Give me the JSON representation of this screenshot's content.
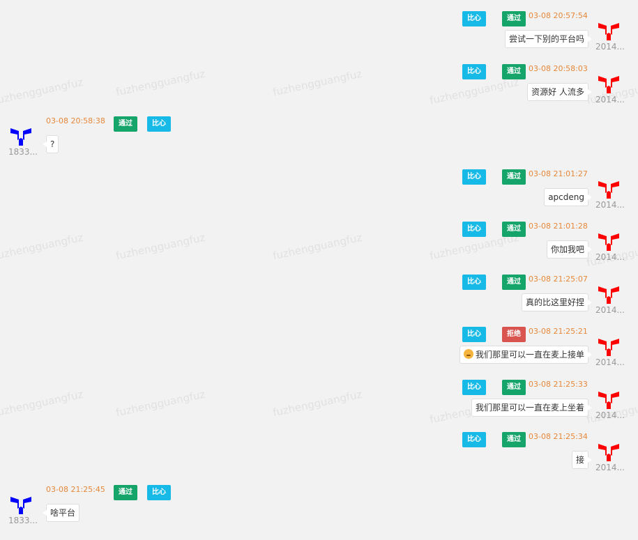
{
  "watermark_text": "fuzhengguangfuz",
  "colors": {
    "self_avatar": "#ff0000",
    "other_avatar": "#0000ff",
    "pass_tag": "#15a46a",
    "reject_tag": "#d9534f",
    "like_tag": "#17b9e6",
    "time": "#e6883b"
  },
  "messages": [
    {
      "side": "right",
      "time": "03-08 20:57:54",
      "status": "通过",
      "like": "比心",
      "text": "尝试一下别的平台吗",
      "user": "2014..."
    },
    {
      "side": "right",
      "time": "03-08 20:58:03",
      "status": "通过",
      "like": "比心",
      "text": "资源好 人流多",
      "user": "2014..."
    },
    {
      "side": "left",
      "time": "03-08 20:58:38",
      "status": "通过",
      "like": "比心",
      "text": "?",
      "user": "1833..."
    },
    {
      "side": "right",
      "time": "03-08 21:01:27",
      "status": "通过",
      "like": "比心",
      "text": "apcdeng",
      "user": "2014..."
    },
    {
      "side": "right",
      "time": "03-08 21:01:28",
      "status": "通过",
      "like": "比心",
      "text": "你加我吧",
      "user": "2014..."
    },
    {
      "side": "right",
      "time": "03-08 21:25:07",
      "status": "通过",
      "like": "比心",
      "text": "真的比这里好捏",
      "user": "2014..."
    },
    {
      "side": "right",
      "time": "03-08 21:25:21",
      "status": "拒绝",
      "like": "比心",
      "text": "我们那里可以一直在麦上接单",
      "user": "2014...",
      "emoji": "thinking-face"
    },
    {
      "side": "right",
      "time": "03-08 21:25:33",
      "status": "通过",
      "like": "比心",
      "text": "我们那里可以一直在麦上坐着",
      "user": "2014..."
    },
    {
      "side": "right",
      "time": "03-08 21:25:34",
      "status": "通过",
      "like": "比心",
      "text": "接",
      "user": "2014..."
    },
    {
      "side": "left",
      "time": "03-08 21:25:45",
      "status": "通过",
      "like": "比心",
      "text": "啥平台",
      "user": "1833..."
    }
  ]
}
